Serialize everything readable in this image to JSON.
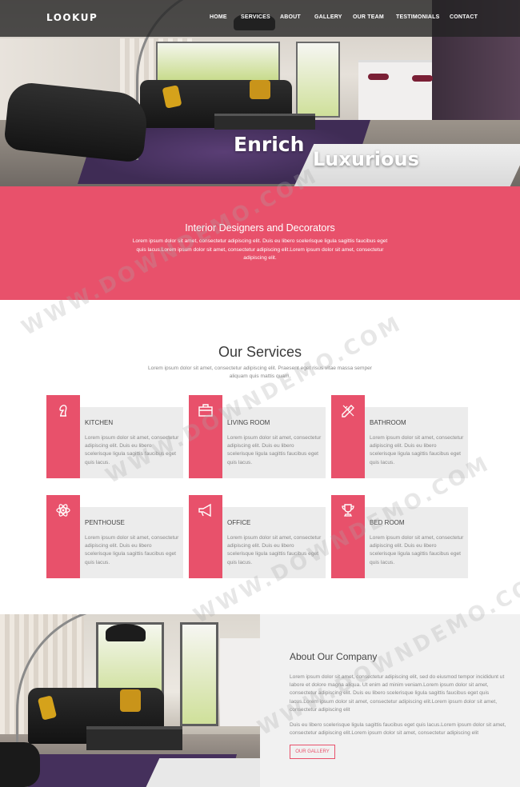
{
  "header": {
    "logo": "LOOKUP",
    "nav": [
      {
        "label": "HOME"
      },
      {
        "label": "SERVICES"
      },
      {
        "label": "ABOUT"
      },
      {
        "label": "GALLERY"
      },
      {
        "label": "OUR TEAM"
      },
      {
        "label": "TESTIMONIALS"
      },
      {
        "label": "CONTACT"
      }
    ]
  },
  "hero": {
    "title_1": "Enrich",
    "title_2": "Luxurious"
  },
  "intro": {
    "title": "Interior Designers and Decorators",
    "text": "Lorem ipsum dolor sit amet, consectetur adipiscing elit. Duis eu libero scelerisque ligula sagittis faucibus eget quis lacus.Lorem ipsum dolor sit amet, consectetur adipiscing elit.Lorem ipsum dolor sit amet, consectetur adipiscing elit."
  },
  "services": {
    "title": "Our Services",
    "subtitle": "Lorem ipsum dolor sit amet, consectetur adipiscing elit. Praesent eget risus vitae massa semper aliquam quis mattis quam.",
    "items": [
      {
        "name": "KITCHEN",
        "icon": "chess-knight-icon",
        "desc": "Lorem ipsum dolor sit amet, consectetur adipiscing elit. Duis eu libero scelerisque ligula sagittis faucibus eget quis lacus."
      },
      {
        "name": "LIVING ROOM",
        "icon": "briefcase-icon",
        "desc": "Lorem ipsum dolor sit amet, consectetur adipiscing elit. Duis eu libero scelerisque ligula sagittis faucibus eget quis lacus."
      },
      {
        "name": "BATHROOM",
        "icon": "pencil-ruler-icon",
        "desc": "Lorem ipsum dolor sit amet, consectetur adipiscing elit. Duis eu libero scelerisque ligula sagittis faucibus eget quis lacus."
      },
      {
        "name": "PENTHOUSE",
        "icon": "atom-icon",
        "desc": "Lorem ipsum dolor sit amet, consectetur adipiscing elit. Duis eu libero scelerisque ligula sagittis faucibus eget quis lacus."
      },
      {
        "name": "OFFICE",
        "icon": "megaphone-icon",
        "desc": "Lorem ipsum dolor sit amet, consectetur adipiscing elit. Duis eu libero scelerisque ligula sagittis faucibus eget quis lacus."
      },
      {
        "name": "BED ROOM",
        "icon": "trophy-icon",
        "desc": "Lorem ipsum dolor sit amet, consectetur adipiscing elit. Duis eu libero scelerisque ligula sagittis faucibus eget quis lacus."
      }
    ]
  },
  "about": {
    "title": "About Our Company",
    "p1": "Lorem ipsum dolor sit amet, consectetur adipiscing elit, sed do eiusmod tempor incididunt ut labore et dolore magna aliqua. Ut enim ad minim veniam.Lorem ipsum dolor sit amet, consectetur adipiscing elit. Duis eu libero scelerisque ligula sagittis faucibus eget quis lacus.Lorem ipsum dolor sit amet, consectetur adipiscing elit.Lorem ipsum dolor sit amet, consectetur adipiscing elit",
    "p2": "Duis eu libero scelerisque ligula sagittis faucibus eget quis lacus.Lorem ipsum dolor sit amet, consectetur adipiscing elit.Lorem ipsum dolor sit amet, consectetur adipiscing elit",
    "button": "OUR GALLERY"
  },
  "watermark": "WWW.DOWNDEMO.COM",
  "colors": {
    "accent": "#e8516b",
    "card_bg": "#ececec",
    "about_bg": "#f1f1f1"
  }
}
